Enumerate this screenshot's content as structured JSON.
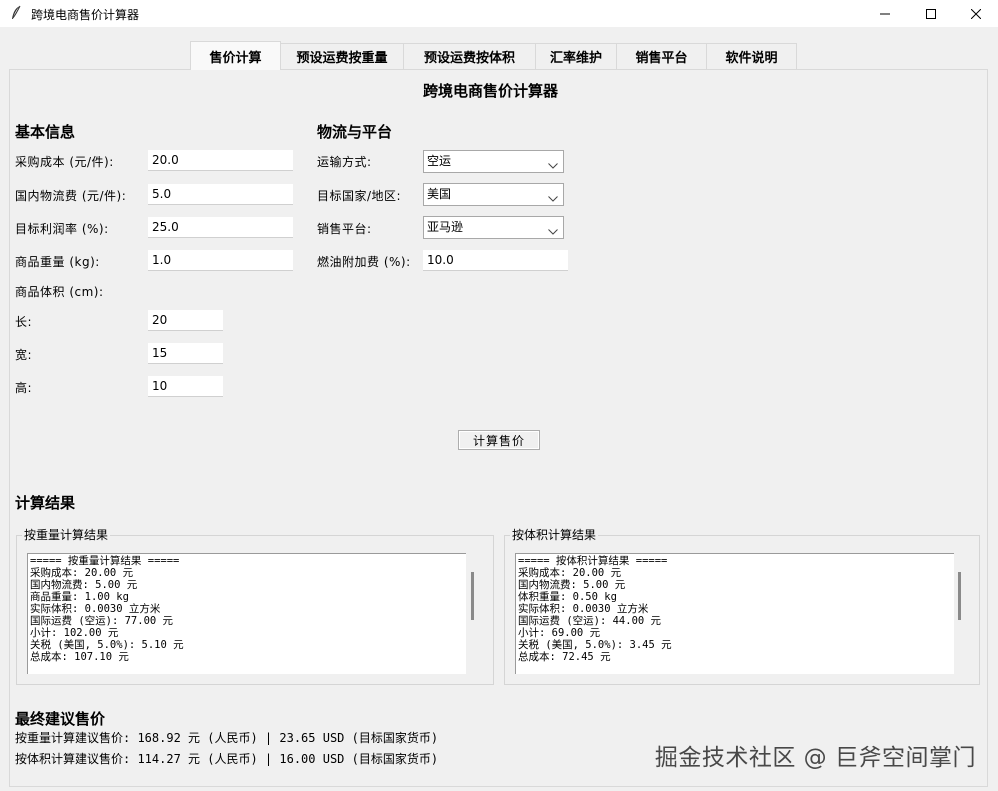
{
  "window": {
    "title": "跨境电商售价计算器",
    "icons": [
      "feather-icon",
      "minimize-icon",
      "maximize-icon",
      "close-icon"
    ]
  },
  "tabs": [
    {
      "label": "售价计算",
      "active": true
    },
    {
      "label": "预设运费按重量",
      "active": false
    },
    {
      "label": "预设运费按体积",
      "active": false
    },
    {
      "label": "汇率维护",
      "active": false
    },
    {
      "label": "销售平台",
      "active": false
    },
    {
      "label": "软件说明",
      "active": false
    }
  ],
  "main": {
    "title": "跨境电商售价计算器",
    "basic": {
      "heading": "基本信息",
      "purchase_cost_label": "采购成本 (元/件):",
      "purchase_cost_value": "20.0",
      "domestic_shipping_label": "国内物流费 (元/件):",
      "domestic_shipping_value": "5.0",
      "profit_rate_label": "目标利润率 (%):",
      "profit_rate_value": "25.0",
      "weight_label": "商品重量 (kg):",
      "weight_value": "1.0",
      "volume_label": "商品体积 (cm):",
      "length_label": "长:",
      "length_value": "20",
      "width_label": "宽:",
      "width_value": "15",
      "height_label": "高:",
      "height_value": "10"
    },
    "logistics": {
      "heading": "物流与平台",
      "shipping_method_label": "运输方式:",
      "shipping_method_value": "空运",
      "country_label": "目标国家/地区:",
      "country_value": "美国",
      "platform_label": "销售平台:",
      "platform_value": "亚马逊",
      "fuel_surcharge_label": "燃油附加费 (%):",
      "fuel_surcharge_value": "10.0"
    },
    "calculate_button": "计算售价"
  },
  "results": {
    "heading": "计算结果",
    "weight_group": {
      "title": "按重量计算结果",
      "lines": [
        "===== 按重量计算结果 =====",
        "采购成本: 20.00 元",
        "国内物流费: 5.00 元",
        "商品重量: 1.00 kg",
        "实际体积: 0.0030 立方米",
        "国际运费 (空运): 77.00 元",
        "小计: 102.00 元",
        "关税 (美国, 5.0%): 5.10 元",
        "总成本: 107.10 元"
      ]
    },
    "volume_group": {
      "title": "按体积计算结果",
      "lines": [
        "===== 按体积计算结果 =====",
        "采购成本: 20.00 元",
        "国内物流费: 5.00 元",
        "体积重量: 0.50 kg",
        "实际体积: 0.0030 立方米",
        "国际运费 (空运): 44.00 元",
        "小计: 69.00 元",
        "关税 (美国, 5.0%): 3.45 元",
        "总成本: 72.45 元"
      ]
    }
  },
  "final": {
    "heading": "最终建议售价",
    "by_weight": "按重量计算建议售价: 168.92 元 (人民币) | 23.65 USD (目标国家货币)",
    "by_volume": "按体积计算建议售价: 114.27 元 (人民币) | 16.00 USD (目标国家货币)"
  },
  "watermark": "掘金技术社区 @ 巨斧空间掌门"
}
